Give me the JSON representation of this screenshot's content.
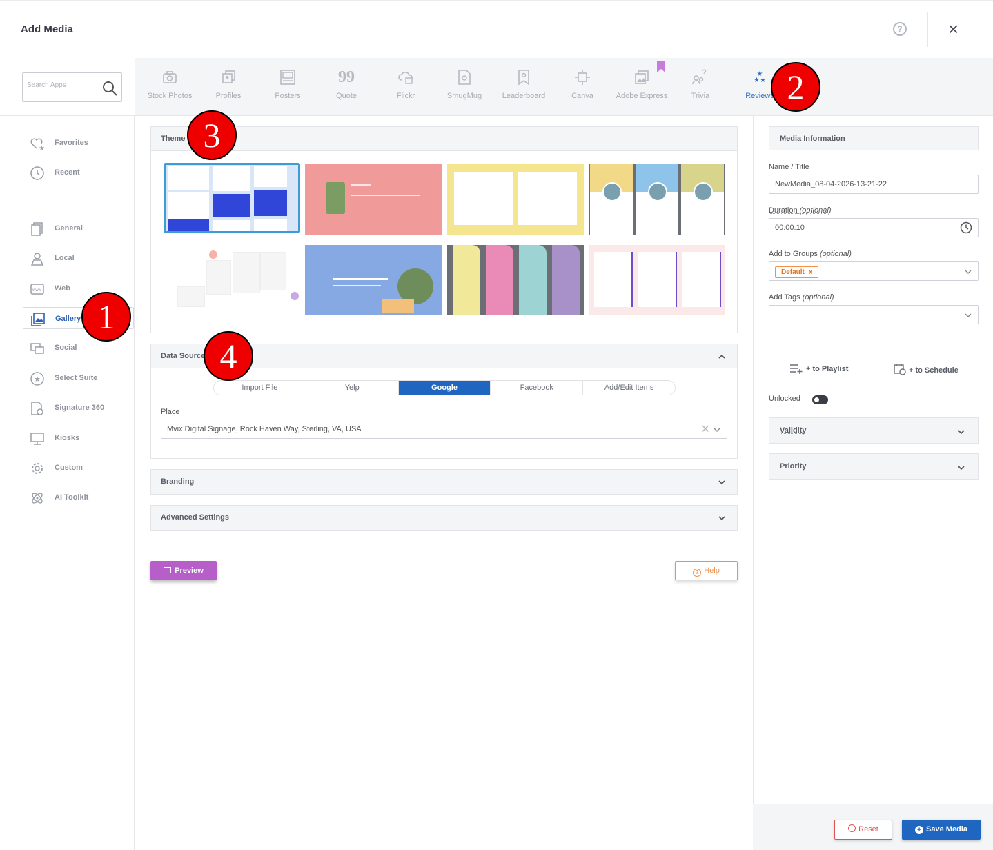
{
  "header": {
    "title": "Add Media",
    "help_glyph": "?",
    "close_glyph": "×"
  },
  "search": {
    "placeholder": "Search Apps"
  },
  "apps": [
    {
      "label": "Stock Photos",
      "icon": "camera-icon"
    },
    {
      "label": "Profiles",
      "icon": "profiles-icon"
    },
    {
      "label": "Posters",
      "icon": "posters-icon"
    },
    {
      "label": "Quote",
      "icon": "quote-icon"
    },
    {
      "label": "Flickr",
      "icon": "flickr-icon"
    },
    {
      "label": "SmugMug",
      "icon": "smugmug-icon"
    },
    {
      "label": "Leaderboard",
      "icon": "leaderboard-icon"
    },
    {
      "label": "Canva",
      "icon": "canva-icon"
    },
    {
      "label": "Adobe Express",
      "icon": "adobe-express-icon"
    },
    {
      "label": "Trivia",
      "icon": "trivia-icon"
    },
    {
      "label": "Reviews",
      "icon": "reviews-icon",
      "active": true
    }
  ],
  "sidebar": {
    "items": [
      {
        "label": "Favorites",
        "icon": "heart-star-icon"
      },
      {
        "label": "Recent",
        "icon": "clock-icon"
      },
      {
        "label": "General",
        "icon": "document-icon"
      },
      {
        "label": "Local",
        "icon": "user-icon"
      },
      {
        "label": "Web",
        "icon": "www-icon"
      },
      {
        "label": "Gallery",
        "icon": "gallery-icon",
        "active": true
      },
      {
        "label": "Social",
        "icon": "social-icon"
      },
      {
        "label": "Select Suite",
        "icon": "star-circle-icon"
      },
      {
        "label": "Signature 360",
        "icon": "signature-icon"
      },
      {
        "label": "Kiosks",
        "icon": "kiosk-icon"
      },
      {
        "label": "Custom",
        "icon": "gear-icon"
      },
      {
        "label": "AI Toolkit",
        "icon": "atom-icon"
      }
    ]
  },
  "themes": {
    "label": "Theme",
    "selected_index": 0
  },
  "datasource": {
    "label": "Data Source",
    "tabs": [
      "Import File",
      "Yelp",
      "Google",
      "Facebook",
      "Add/Edit Items"
    ],
    "active_tab": "Google",
    "place_label": "Place",
    "place_value": "Mvix Digital Signage, Rock Haven Way, Sterling, VA, USA"
  },
  "branding": {
    "label": "Branding"
  },
  "advanced": {
    "label": "Advanced Settings"
  },
  "buttons": {
    "preview": "Preview",
    "help": "Help",
    "reset": "Reset",
    "save": "Save Media"
  },
  "media_info": {
    "header": "Media Information",
    "name_label": "Name / Title",
    "name_value": "NewMedia_08-04-2026-13-21-22",
    "duration_label": "Duration",
    "duration_optional": "(optional)",
    "duration_value": "00:00:10",
    "groups_label": "Add to Groups",
    "groups_optional": "(optional)",
    "group_tag": "Default",
    "group_tag_remove": "x",
    "tags_label": "Add Tags",
    "tags_optional": "(optional)",
    "playlist": "+ to Playlist",
    "schedule": "+ to Schedule",
    "unlocked": "Unlocked",
    "validity": "Validity",
    "priority": "Priority"
  },
  "markers": [
    "1",
    "2",
    "3",
    "4"
  ],
  "colors": {
    "accent": "#1f66c1",
    "preview": "#b65fc8",
    "help": "#f0934a",
    "reset": "#e05252",
    "marker": "#ee0000"
  }
}
